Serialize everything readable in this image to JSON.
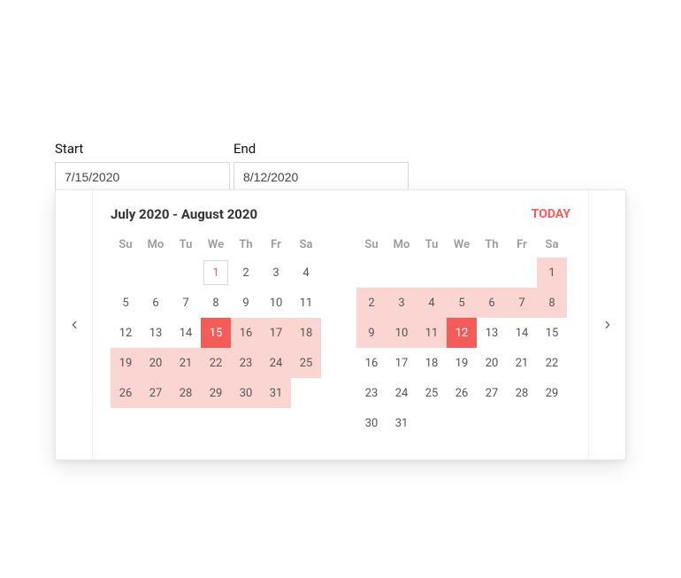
{
  "fields": {
    "start_label": "Start",
    "end_label": "End",
    "start_value": "7/15/2020",
    "end_value": "8/12/2020"
  },
  "header": {
    "range_title": "July 2020 - August 2020",
    "today_label": "TODAY"
  },
  "dow": [
    "Su",
    "Mo",
    "Tu",
    "We",
    "Th",
    "Fr",
    "Sa"
  ],
  "months": [
    {
      "weeks": [
        [
          {
            "blank": true
          },
          {
            "blank": true
          },
          {
            "blank": true
          },
          {
            "n": 1,
            "today_outline": true,
            "red_text": true
          },
          {
            "n": 2
          },
          {
            "n": 3
          },
          {
            "n": 4
          }
        ],
        [
          {
            "n": 5
          },
          {
            "n": 6
          },
          {
            "n": 7
          },
          {
            "n": 8
          },
          {
            "n": 9
          },
          {
            "n": 10
          },
          {
            "n": 11
          }
        ],
        [
          {
            "n": 12
          },
          {
            "n": 13
          },
          {
            "n": 14
          },
          {
            "n": 15,
            "selected": true
          },
          {
            "n": 16,
            "in_range": true
          },
          {
            "n": 17,
            "in_range": true
          },
          {
            "n": 18,
            "in_range": true
          }
        ],
        [
          {
            "n": 19,
            "in_range": true
          },
          {
            "n": 20,
            "in_range": true
          },
          {
            "n": 21,
            "in_range": true
          },
          {
            "n": 22,
            "in_range": true
          },
          {
            "n": 23,
            "in_range": true
          },
          {
            "n": 24,
            "in_range": true
          },
          {
            "n": 25,
            "in_range": true
          }
        ],
        [
          {
            "n": 26,
            "in_range": true
          },
          {
            "n": 27,
            "in_range": true
          },
          {
            "n": 28,
            "in_range": true
          },
          {
            "n": 29,
            "in_range": true
          },
          {
            "n": 30,
            "in_range": true
          },
          {
            "n": 31,
            "in_range": true
          },
          {
            "blank": true
          }
        ]
      ]
    },
    {
      "weeks": [
        [
          {
            "blank": true
          },
          {
            "blank": true
          },
          {
            "blank": true
          },
          {
            "blank": true
          },
          {
            "blank": true
          },
          {
            "blank": true
          },
          {
            "n": 1,
            "in_range": true
          }
        ],
        [
          {
            "n": 2,
            "in_range": true
          },
          {
            "n": 3,
            "in_range": true
          },
          {
            "n": 4,
            "in_range": true
          },
          {
            "n": 5,
            "in_range": true
          },
          {
            "n": 6,
            "in_range": true
          },
          {
            "n": 7,
            "in_range": true
          },
          {
            "n": 8,
            "in_range": true
          }
        ],
        [
          {
            "n": 9,
            "in_range": true
          },
          {
            "n": 10,
            "in_range": true
          },
          {
            "n": 11,
            "in_range": true
          },
          {
            "n": 12,
            "selected": true
          },
          {
            "n": 13
          },
          {
            "n": 14
          },
          {
            "n": 15
          }
        ],
        [
          {
            "n": 16
          },
          {
            "n": 17
          },
          {
            "n": 18
          },
          {
            "n": 19
          },
          {
            "n": 20
          },
          {
            "n": 21
          },
          {
            "n": 22
          }
        ],
        [
          {
            "n": 23
          },
          {
            "n": 24
          },
          {
            "n": 25
          },
          {
            "n": 26
          },
          {
            "n": 27
          },
          {
            "n": 28
          },
          {
            "n": 29
          }
        ],
        [
          {
            "n": 30
          },
          {
            "n": 31
          },
          {
            "blank": true
          },
          {
            "blank": true
          },
          {
            "blank": true
          },
          {
            "blank": true
          },
          {
            "blank": true
          }
        ]
      ]
    }
  ]
}
